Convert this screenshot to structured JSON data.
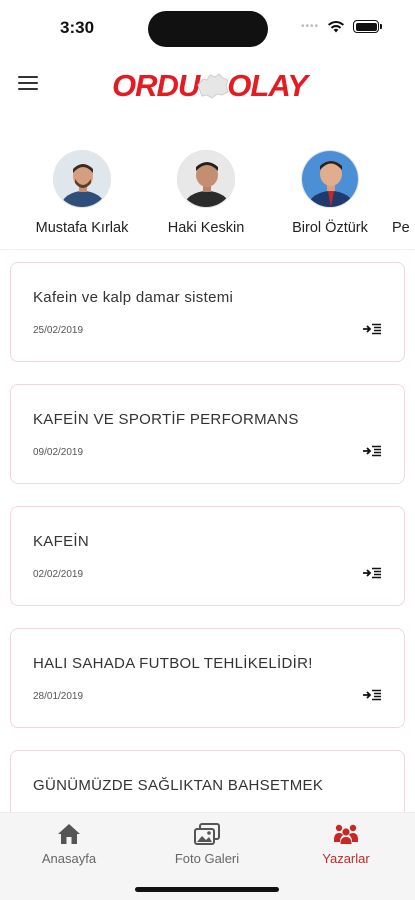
{
  "status": {
    "time": "3:30"
  },
  "header": {
    "logo_left": "ORDU",
    "logo_right": "OLAY",
    "brand_color": "#e31b23"
  },
  "authors": [
    {
      "name": "Mustafa Kırlak",
      "active": false
    },
    {
      "name": "Haki Keskin",
      "active": true
    },
    {
      "name": "Birol Öztürk",
      "active": false
    },
    {
      "name": "Pe",
      "active": false
    }
  ],
  "articles": [
    {
      "title": "Kafein ve kalp damar sistemi",
      "date": "25/02/2019"
    },
    {
      "title": "KAFEİN VE SPORTİF PERFORMANS",
      "date": "09/02/2019"
    },
    {
      "title": "KAFEİN",
      "date": "02/02/2019"
    },
    {
      "title": "HALI SAHADA FUTBOL TEHLİKELİDİR!",
      "date": "28/01/2019"
    },
    {
      "title": "GÜNÜMÜZDE SAĞLIKTAN BAHSETMEK",
      "date": ""
    }
  ],
  "tabbar": {
    "home_label": "Anasayfa",
    "gallery_label": "Foto Galeri",
    "authors_label": "Yazarlar",
    "active_color": "#c62828"
  }
}
